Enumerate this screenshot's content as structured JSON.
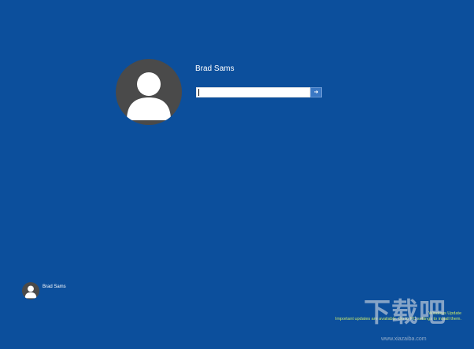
{
  "login": {
    "username": "Brad Sams",
    "password_value": "",
    "submit_symbol": "➜"
  },
  "user_list": {
    "items": [
      {
        "name": "Brad Sams"
      }
    ]
  },
  "notification": {
    "title": "Windows Update",
    "detail": "Important updates are available. Go to PC settings to install them."
  },
  "watermark": {
    "logo_text": "下载吧",
    "url": "www.xiazaiba.com"
  },
  "colors": {
    "background": "#0c4f9c",
    "avatar_bg": "#4a4a4a",
    "notification_text": "#c8e86b"
  },
  "icons": {
    "avatar": "user-silhouette-icon",
    "submit": "arrow-right-icon"
  }
}
